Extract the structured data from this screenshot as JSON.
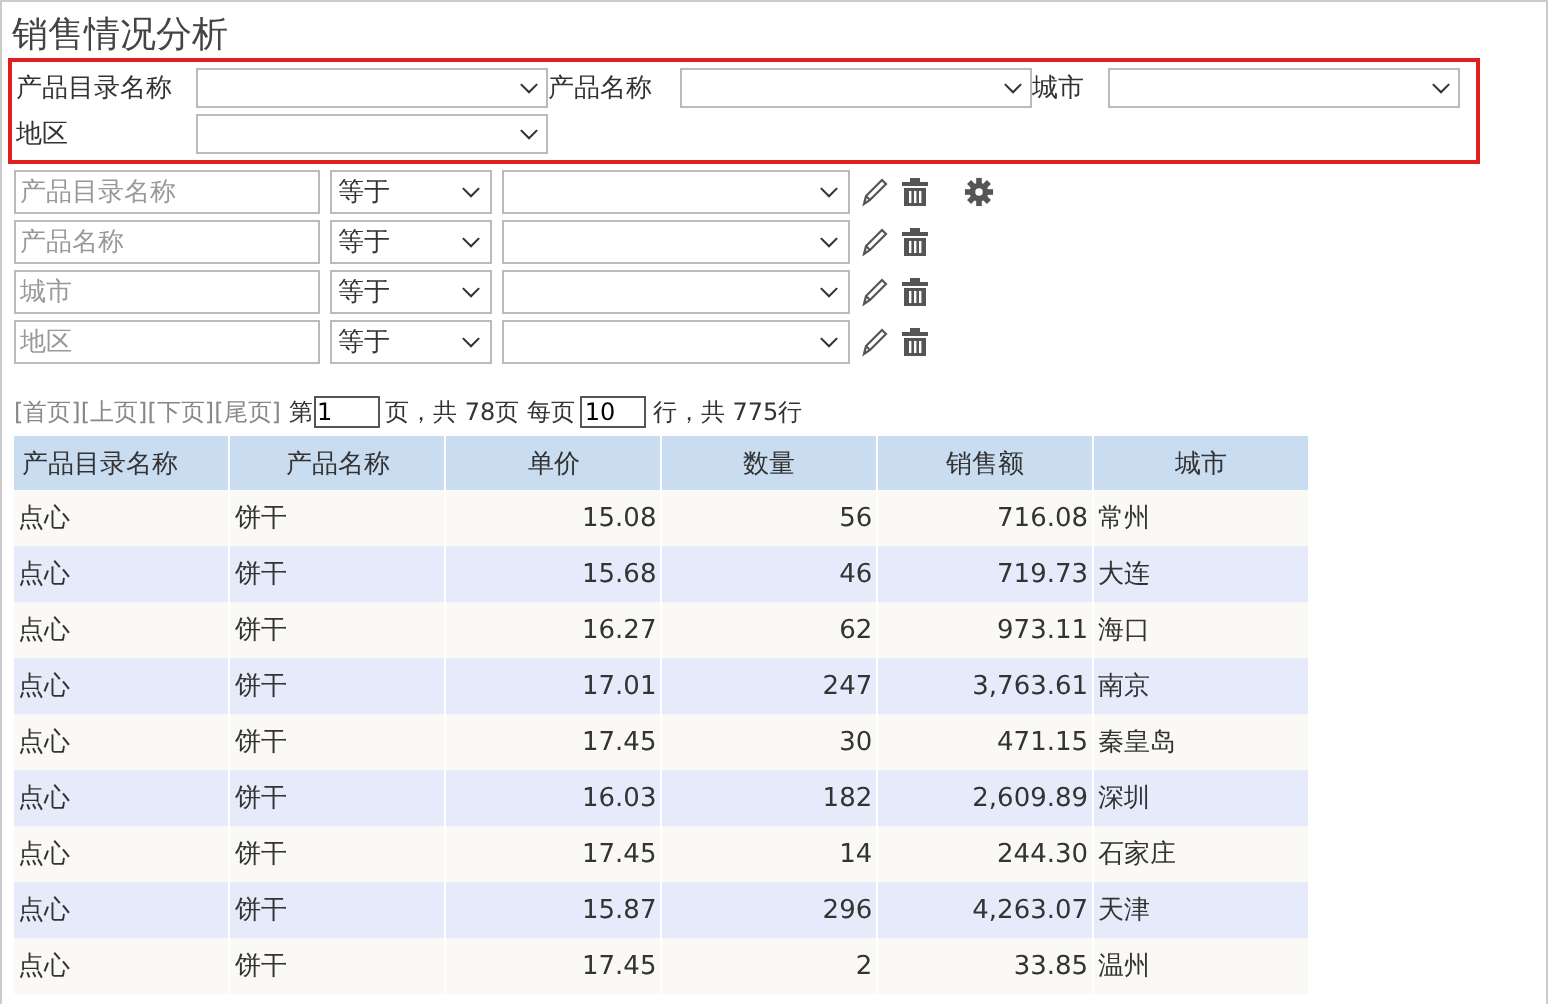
{
  "title": "销售情况分析",
  "filter_panel": {
    "fields": [
      {
        "label": "产品目录名称"
      },
      {
        "label": "产品名称"
      },
      {
        "label": "城市"
      },
      {
        "label": "地区"
      }
    ]
  },
  "conditions": [
    {
      "field_placeholder": "产品目录名称",
      "operator": "等于",
      "settings": true
    },
    {
      "field_placeholder": "产品名称",
      "operator": "等于",
      "settings": false
    },
    {
      "field_placeholder": "城市",
      "operator": "等于",
      "settings": false
    },
    {
      "field_placeholder": "地区",
      "operator": "等于",
      "settings": false
    }
  ],
  "pager": {
    "links": [
      "[首页]",
      "[上页]",
      "[下页]",
      "[尾页]"
    ],
    "page_prefix": "第",
    "page": "1",
    "page_suffix": "页，共 78页 每页",
    "page_size": "10",
    "total": "行，共 775行"
  },
  "table": {
    "columns": [
      "产品目录名称",
      "产品名称",
      "单价",
      "数量",
      "销售额",
      "城市"
    ],
    "rows": [
      [
        "点心",
        "饼干",
        "15.08",
        "56",
        "716.08",
        "常州"
      ],
      [
        "点心",
        "饼干",
        "15.68",
        "46",
        "719.73",
        "大连"
      ],
      [
        "点心",
        "饼干",
        "16.27",
        "62",
        "973.11",
        "海口"
      ],
      [
        "点心",
        "饼干",
        "17.01",
        "247",
        "3,763.61",
        "南京"
      ],
      [
        "点心",
        "饼干",
        "17.45",
        "30",
        "471.15",
        "秦皇岛"
      ],
      [
        "点心",
        "饼干",
        "16.03",
        "182",
        "2,609.89",
        "深圳"
      ],
      [
        "点心",
        "饼干",
        "17.45",
        "14",
        "244.30",
        "石家庄"
      ],
      [
        "点心",
        "饼干",
        "15.87",
        "296",
        "4,263.07",
        "天津"
      ],
      [
        "点心",
        "饼干",
        "17.45",
        "2",
        "33.85",
        "温州"
      ]
    ]
  }
}
